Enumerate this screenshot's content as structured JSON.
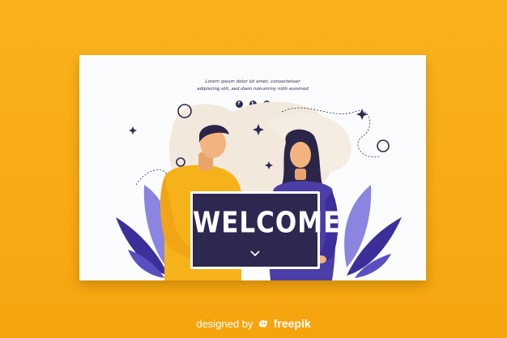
{
  "tagline": {
    "line1": "Lorem ipsum dolor sit amet, consectetuer",
    "line2": "adipiscing elit, sed diam nonummy nibh euismod"
  },
  "socials": [
    {
      "name": "facebook-icon",
      "glyph": "f"
    },
    {
      "name": "twitter-icon",
      "glyph": "t"
    },
    {
      "name": "instagram-icon",
      "glyph": "◎"
    }
  ],
  "board": {
    "title": "WELCOME"
  },
  "footer": {
    "designed_by": "designed by",
    "brand": "freepik"
  },
  "colors": {
    "background": "#f9b21c",
    "card": "#fbfcfd",
    "navy": "#2d2850",
    "yellow_shirt": "#f6b21a",
    "purple_dress": "#4b3ea6",
    "skin": "#f3b37f",
    "hair": "#2b2548"
  }
}
